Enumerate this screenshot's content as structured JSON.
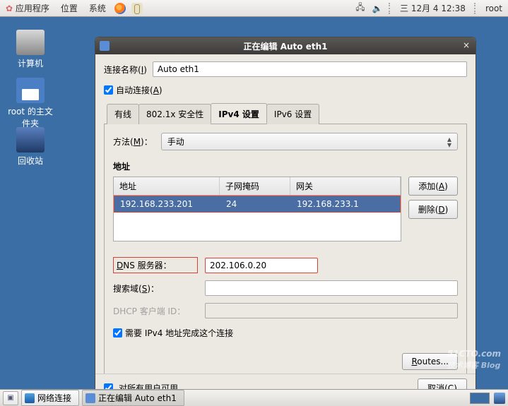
{
  "panel": {
    "apps": "应用程序",
    "places": "位置",
    "system": "系统",
    "clock": "三 12月  4 12:38",
    "user": "root"
  },
  "desktop": {
    "computer": "计算机",
    "home": "root 的主文件夹",
    "trash": "回收站"
  },
  "dialog": {
    "title": "正在编辑 Auto eth1",
    "name_label_pre": "连接名称(",
    "name_label_u": "I",
    "name_label_post": ")",
    "name_value": "Auto eth1",
    "auto_connect_pre": "自动连接(",
    "auto_connect_u": "A",
    "auto_connect_post": ")",
    "tabs": {
      "wired": "有线",
      "security": "802.1x 安全性",
      "ipv4": "IPv4 设置",
      "ipv6": "IPv6 设置"
    },
    "ipv4": {
      "method_label_pre": "方法(",
      "method_label_u": "M",
      "method_label_post": ")：",
      "method_value": "手动",
      "addr_heading": "地址",
      "col_addr": "地址",
      "col_mask": "子网掩码",
      "col_gw": "网关",
      "row": {
        "addr": "192.168.233.201",
        "mask": "24",
        "gw": "192.168.233.1"
      },
      "add_pre": "添加(",
      "add_u": "A",
      "add_post": ")",
      "del_pre": "删除(",
      "del_u": "D",
      "del_post": ")",
      "dns_label_pre": "",
      "dns_label_u": "D",
      "dns_label_mid": "NS 服务器：",
      "dns_value": "202.106.0.20",
      "search_pre": "搜索域(",
      "search_u": "S",
      "search_post": ")：",
      "dhcp_label": "DHCP 客户端 ID：",
      "require_label": "需要 IPv4 地址完成这个连接",
      "routes_pre": "",
      "routes_u": "R",
      "routes_post": "outes..."
    },
    "all_users": "对所有用户可用",
    "cancel_pre": "取消(",
    "cancel_u": "C",
    "cancel_post": ")"
  },
  "taskbar": {
    "net": "网络连接",
    "editing": "正在编辑 Auto eth1"
  },
  "watermark": {
    "main": "51CTO.com",
    "sub": "技术博客      Blog"
  }
}
